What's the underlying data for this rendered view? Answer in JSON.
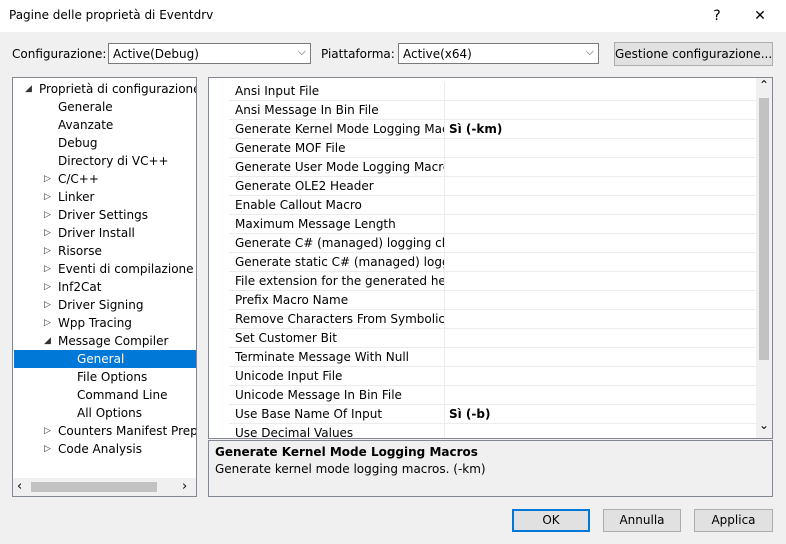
{
  "window": {
    "title": "Pagine delle proprietà di Eventdrv",
    "help_glyph": "?",
    "close_glyph": "✕"
  },
  "config": {
    "config_label": "Configurazione:",
    "config_value": "Active(Debug)",
    "platform_label": "Piattaforma:",
    "platform_value": "Active(x64)",
    "manager_button": "Gestione configurazione..."
  },
  "tree": {
    "root": "Proprietà di configurazione",
    "items": [
      {
        "label": "Generale"
      },
      {
        "label": "Avanzate"
      },
      {
        "label": "Debug"
      },
      {
        "label": "Directory di VC++"
      },
      {
        "label": "C/C++"
      },
      {
        "label": "Linker"
      },
      {
        "label": "Driver Settings"
      },
      {
        "label": "Driver Install"
      },
      {
        "label": "Risorse"
      },
      {
        "label": "Eventi di compilazione"
      },
      {
        "label": "Inf2Cat"
      },
      {
        "label": "Driver Signing"
      },
      {
        "label": "Wpp Tracing"
      },
      {
        "label": "Message Compiler"
      },
      {
        "label": "General"
      },
      {
        "label": "File Options"
      },
      {
        "label": "Command Line"
      },
      {
        "label": "All Options"
      },
      {
        "label": "Counters Manifest Preprocessor"
      },
      {
        "label": "Code Analysis"
      }
    ]
  },
  "grid": {
    "rows": [
      {
        "name": "Ansi Input File",
        "value": ""
      },
      {
        "name": "Ansi Message In Bin File",
        "value": ""
      },
      {
        "name": "Generate Kernel Mode Logging Macros",
        "value": "Sì (-km)"
      },
      {
        "name": "Generate MOF File",
        "value": ""
      },
      {
        "name": "Generate User Mode Logging Macros",
        "value": ""
      },
      {
        "name": "Generate OLE2 Header",
        "value": ""
      },
      {
        "name": "Enable Callout Macro",
        "value": ""
      },
      {
        "name": "Maximum Message Length",
        "value": ""
      },
      {
        "name": "Generate C# (managed) logging class",
        "value": ""
      },
      {
        "name": "Generate static C# (managed) logging class",
        "value": ""
      },
      {
        "name": "File extension for the generated header",
        "value": ""
      },
      {
        "name": "Prefix Macro Name",
        "value": ""
      },
      {
        "name": "Remove Characters From Symbolic Name",
        "value": ""
      },
      {
        "name": "Set Customer Bit",
        "value": ""
      },
      {
        "name": "Terminate Message With Null",
        "value": ""
      },
      {
        "name": "Unicode Input File",
        "value": ""
      },
      {
        "name": "Unicode Message In Bin File",
        "value": ""
      },
      {
        "name": "Use Base Name Of Input",
        "value": "Sì (-b)"
      },
      {
        "name": "Use Decimal Values",
        "value": ""
      }
    ]
  },
  "description": {
    "title": "Generate Kernel Mode Logging Macros",
    "text": "Generate kernel mode logging macros. (-km)"
  },
  "buttons": {
    "ok": "OK",
    "cancel": "Annulla",
    "apply": "Applica"
  },
  "icons": {
    "expanded": "◢",
    "collapsed": "▷",
    "dropdown": "⌵",
    "scroll_up": "⌃",
    "scroll_down": "⌄",
    "scroll_left": "‹",
    "scroll_right": "›"
  }
}
